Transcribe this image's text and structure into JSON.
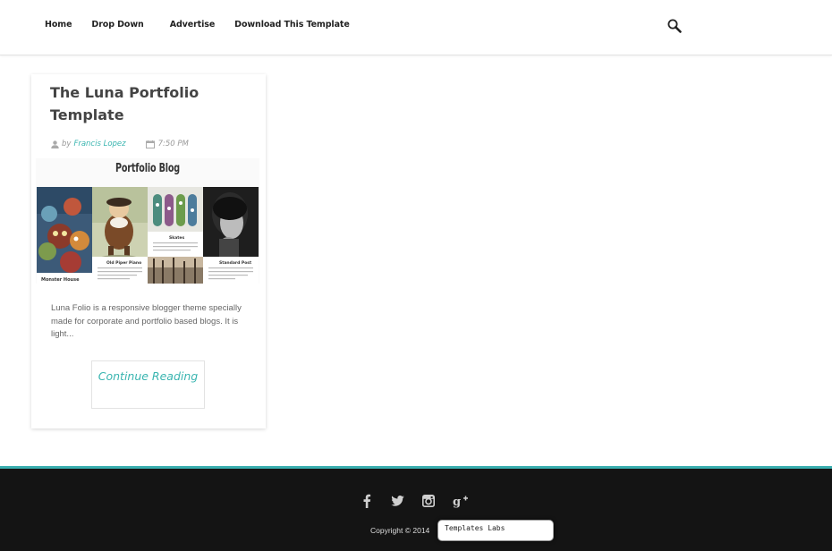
{
  "nav": {
    "items": [
      {
        "label": "Home"
      },
      {
        "label": "Drop Down"
      },
      {
        "label": "Advertise"
      },
      {
        "label": "Download This Template"
      }
    ],
    "search_icon": "magnifier-icon"
  },
  "post": {
    "title": "The Luna Portfolio Template",
    "meta": {
      "by": "by",
      "author": "Francis Lopez",
      "time": "7:50 PM",
      "author_icon": "user-icon",
      "time_icon": "calendar-icon"
    },
    "thumbnail": {
      "heading": "Portfolio Blog",
      "captions": [
        "Monster House",
        "Old Piper Piano",
        "Skates",
        "Standard Post"
      ]
    },
    "excerpt": "Luna Folio is a responsive blogger theme specially made for corporate and portfolio based blogs. It is light...",
    "continue_label": "Continue Reading"
  },
  "footer": {
    "social": [
      "facebook-icon",
      "twitter-icon",
      "instagram-icon",
      "google-plus-icon"
    ],
    "copyright": "Copyright © 2014",
    "credit": "Templates Labs"
  },
  "colors": {
    "accent": "#3ab5b0",
    "footer_bg": "#141414",
    "footer_border": "#3aaeaf"
  }
}
